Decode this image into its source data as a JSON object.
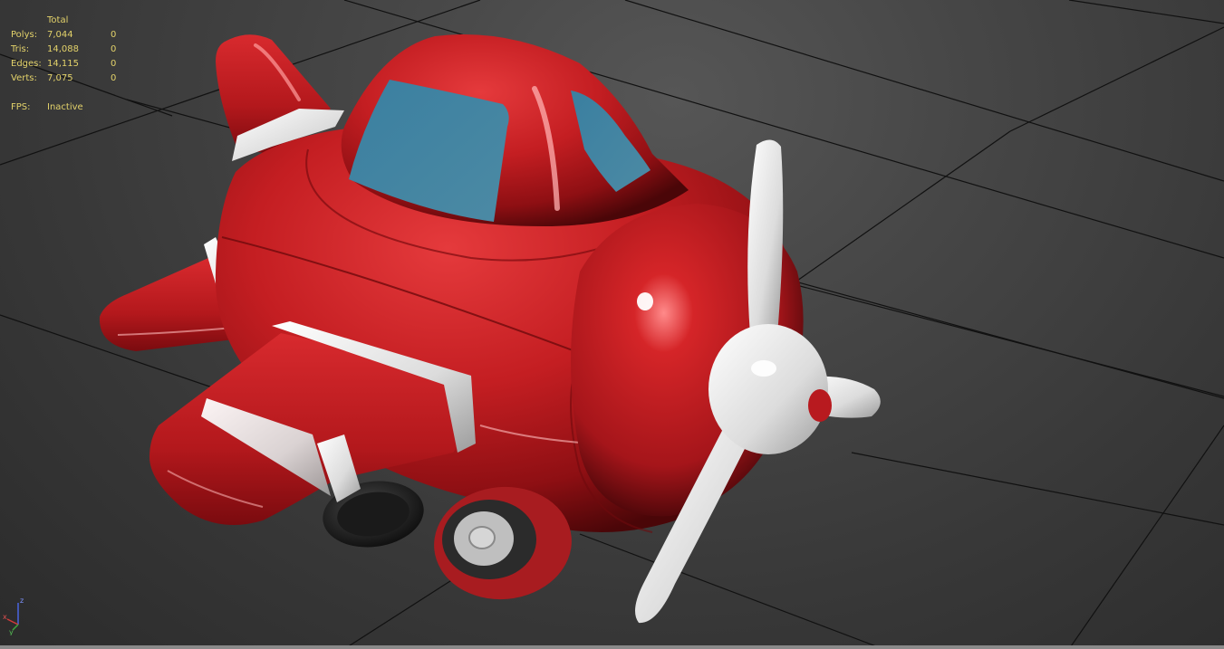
{
  "stats": {
    "header": "Total",
    "rows": [
      {
        "label": "Polys:",
        "total": "7,044",
        "selected": "0"
      },
      {
        "label": "Tris:",
        "total": "14,088",
        "selected": "0"
      },
      {
        "label": "Edges:",
        "total": "14,115",
        "selected": "0"
      },
      {
        "label": "Verts:",
        "total": "7,075",
        "selected": "0"
      }
    ],
    "fps_label": "FPS:",
    "fps_value": "Inactive"
  },
  "gizmo": {
    "x": "x",
    "y": "y",
    "z": "z"
  },
  "colors": {
    "stats_text": "#e3d26a",
    "plane_red": "#c41e22",
    "canopy_blue": "#3f7f98",
    "trim_white": "#e6e6e6",
    "grid_line": "#111111",
    "axis_x": "#d23a3a",
    "axis_y": "#3ea53e",
    "axis_z": "#4a64e0"
  }
}
